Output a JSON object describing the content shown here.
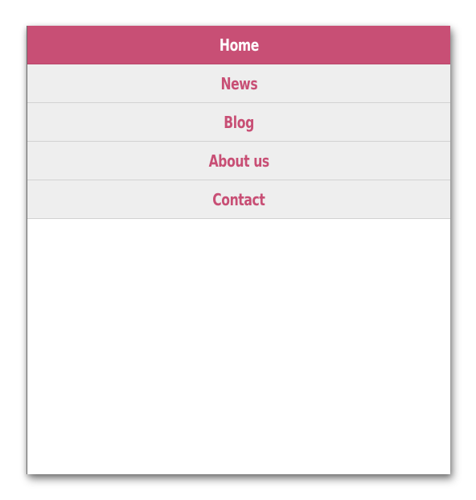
{
  "nav": {
    "items": [
      {
        "label": "Home",
        "active": true
      },
      {
        "label": "News",
        "active": false
      },
      {
        "label": "Blog",
        "active": false
      },
      {
        "label": "About us",
        "active": false
      },
      {
        "label": "Contact",
        "active": false
      }
    ]
  },
  "colors": {
    "accent": "#c84f75",
    "item_background": "#eeeeee",
    "divider": "#d2d2d2",
    "active_text": "#ffffff"
  }
}
